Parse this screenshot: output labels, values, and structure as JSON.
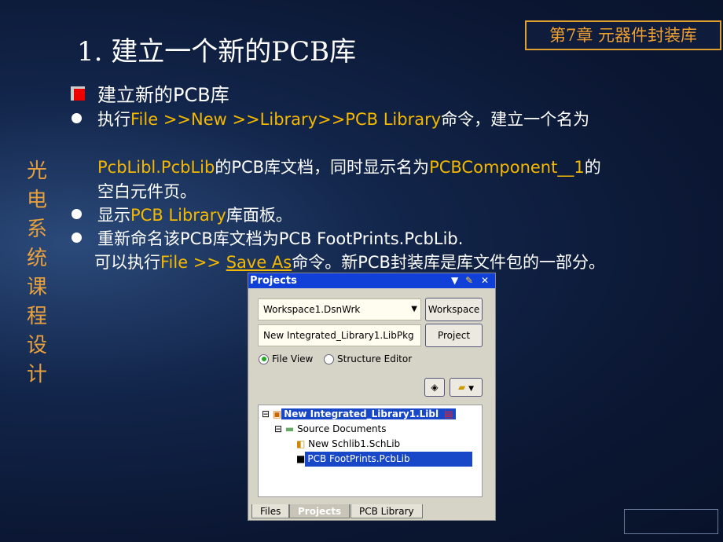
{
  "title": "1.  建立一个新的PCB库",
  "chapter": "第7章  元器件封装库",
  "side_title": [
    "光",
    "电",
    "系",
    "统",
    "课",
    "程",
    "设",
    "计"
  ],
  "heading": "建立新的PCB库",
  "bullets": {
    "b1": {
      "a": "执行",
      "b": "File >>New >>Library>>PCB Library",
      "c": "命令，建立一个名为"
    },
    "b1l2": {
      "a": "PcbLibl.PcbLib",
      "b": "的PCB库文档，同时显示名为",
      "c": "PCBComponent__1",
      "d": "的"
    },
    "b1l3": "空白元件页。",
    "b2": {
      "a": "显示",
      "b": "PCB Library",
      "c": "库面板。"
    },
    "b3": "重新命名该PCB库文档为PCB FootPrints.PcbLib.",
    "b3l2": {
      "a": "可以执行",
      "b": "File >> ",
      "c": "Save As",
      "d": "命令。新PCB封装库是库文件包的一部分。"
    }
  },
  "panel": {
    "title": "Projects",
    "workspace_value": "Workspace1.DsnWrk",
    "project_value": "New Integrated_Library1.LibPkg",
    "workspace_button": "Workspace",
    "project_button": "Project",
    "radio_file_view": "File View",
    "radio_structure": "Structure Editor",
    "selected_view": "File View",
    "tree": {
      "root": "New Integrated_Library1.Libl",
      "folder": "Source Documents",
      "items": [
        "New Schlib1.SchLib",
        "PCB FootPrints.PcbLib"
      ]
    },
    "tabs": [
      "Files",
      "Projects",
      "PCB Library"
    ],
    "active_tab": "Projects"
  }
}
